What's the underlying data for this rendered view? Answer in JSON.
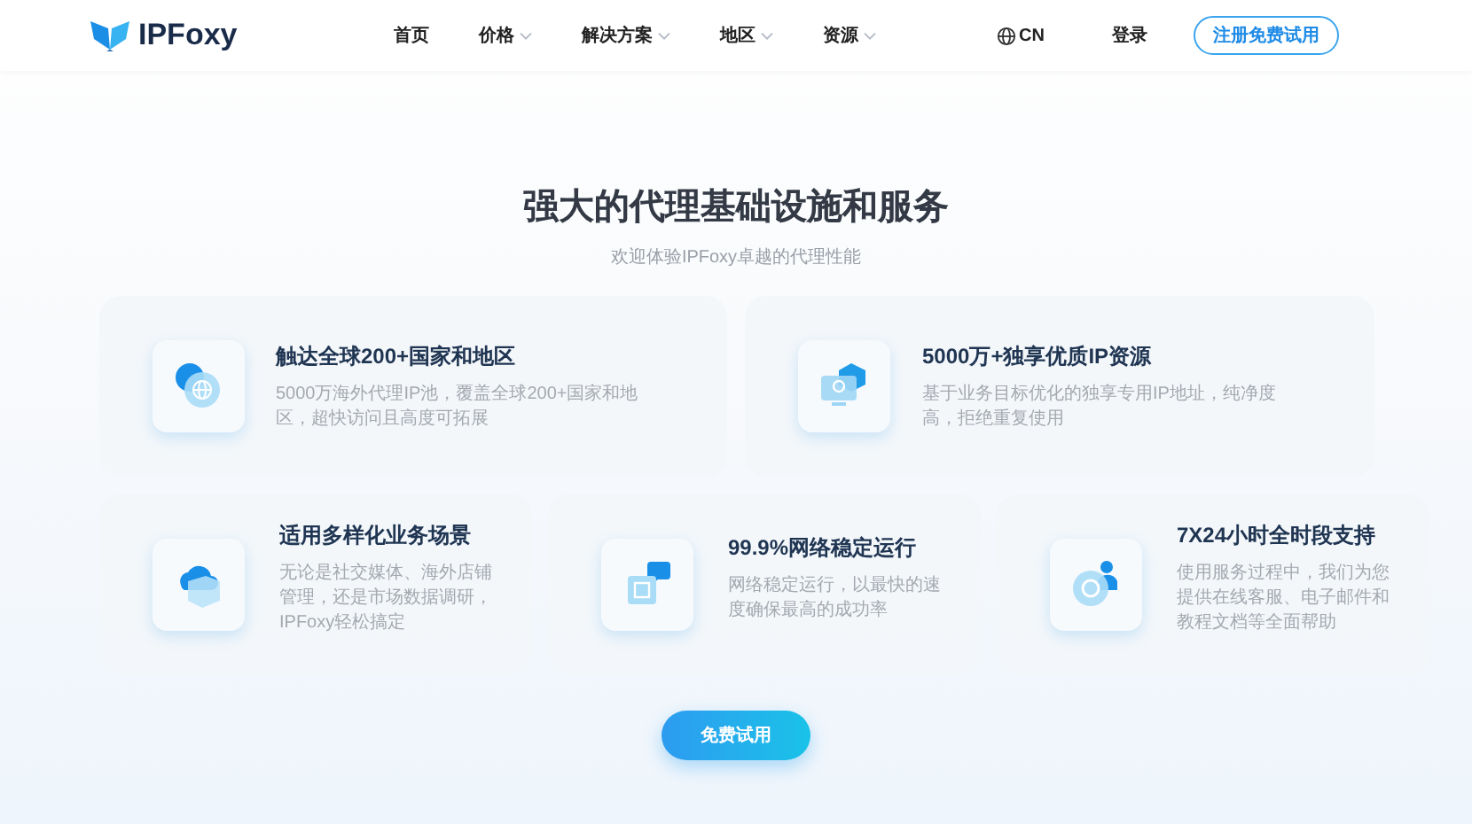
{
  "header": {
    "logo": "IPFoxy",
    "nav": [
      {
        "label": "首页",
        "has_dropdown": false
      },
      {
        "label": "价格",
        "has_dropdown": true
      },
      {
        "label": "解决方案",
        "has_dropdown": true
      },
      {
        "label": "地区",
        "has_dropdown": true
      },
      {
        "label": "资源",
        "has_dropdown": true
      }
    ],
    "language": "CN",
    "login": "登录",
    "signup": "注册免费试用"
  },
  "hero": {
    "title": "强大的代理基础设施和服务",
    "subtitle": "欢迎体验IPFoxy卓越的代理性能"
  },
  "features": [
    {
      "kind": "globe",
      "title": "触达全球200+国家和地区",
      "description": "5000万海外代理IP池，覆盖全球200+国家和地区，超快访问且高度可拓展"
    },
    {
      "kind": "monitor",
      "title": "5000万+独享优质IP资源",
      "description": "基于业务目标优化的独享专用IP地址，纯净度高，拒绝重复使用"
    },
    {
      "kind": "cloud",
      "title": "适用多样化业务场景",
      "description": "无论是社交媒体、海外店铺管理，还是市场数据调研，IPFoxy轻松搞定"
    },
    {
      "kind": "chip",
      "title": "99.9%网络稳定运行",
      "description": "网络稳定运行，以最快的速度确保最高的成功率"
    },
    {
      "kind": "support",
      "title": "7X24小时全时段支持",
      "description": "使用服务过程中，我们为您提供在线客服、电子邮件和教程文档等全面帮助"
    }
  ],
  "cta": "免费试用"
}
